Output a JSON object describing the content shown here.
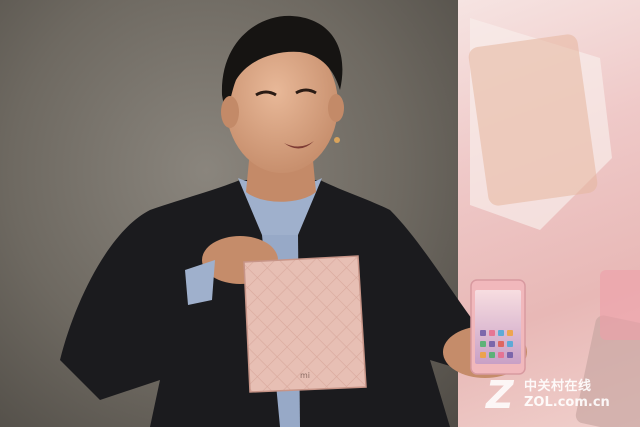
{
  "photo": {
    "subject": "presenter-holding-box-and-phone",
    "background_color_left": "#6e6961",
    "background_color_right": "#efc9c8",
    "box_color": "#e7bfb4",
    "phone_color": "#f1b8bc"
  },
  "box": {
    "logo_text": "mi"
  },
  "watermark": {
    "logo_letter": "Z",
    "chinese_text": "中关村在线",
    "domain_text": "ZOL.com.cn"
  }
}
